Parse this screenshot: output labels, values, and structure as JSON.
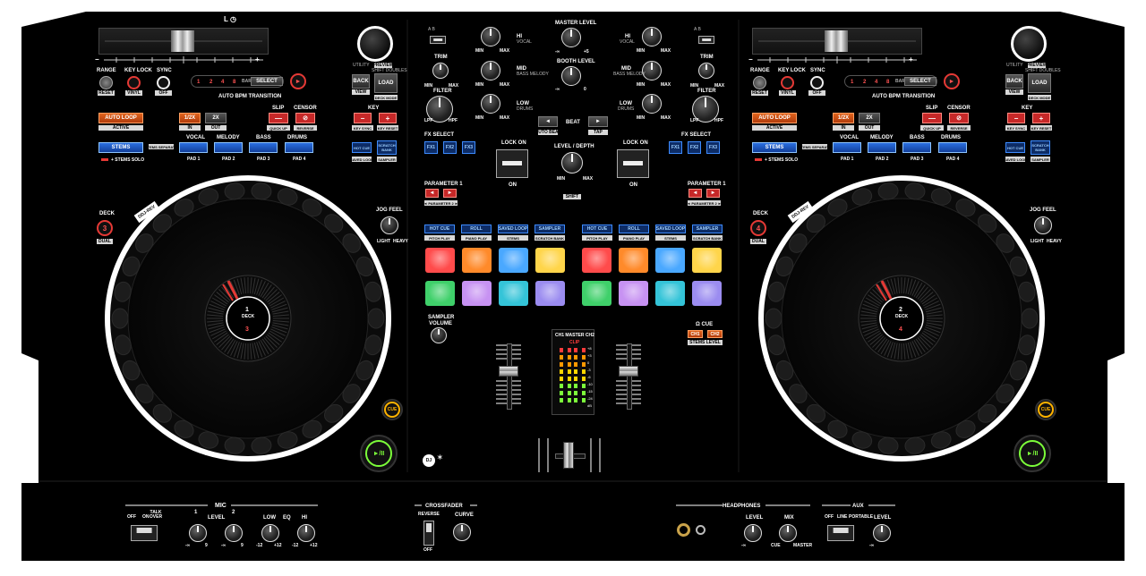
{
  "top_indicator": "L ◷",
  "deck_left": {
    "tempo_plus": "+",
    "tempo_minus": "−",
    "range": "RANGE",
    "range_sub": "RESET",
    "key_lock": "KEY LOCK",
    "key_lock_sub": "VINYL",
    "sync": "SYNC",
    "sync_sub": "OFF",
    "beat_nums": [
      "1",
      "2",
      "4",
      "8"
    ],
    "beat_unit": "BAR",
    "select": "SELECT",
    "auto_bpm": "AUTO BPM TRANSITION",
    "utility": "UTILITY",
    "preview": "PREVIEW",
    "shift_doubles": "SHIFT DOUBLES",
    "back": "BACK",
    "back_sub": "VIEW",
    "load": "LOAD",
    "load_sub": "DECK MODE",
    "auto_loop": "AUTO LOOP",
    "active": "ACTIVE",
    "half": "1/2X",
    "half_sub": "IN",
    "double": "2X",
    "double_sub": "OUT",
    "slip": "SLIP",
    "censor": "CENSOR",
    "slip_sub": "QUICK UP",
    "censor_sub": "REVERSE",
    "key": "KEY",
    "key_sub1": "KEY SYNC",
    "key_sub2": "KEY RESET",
    "stems": "STEMS",
    "stems_separate": "STEMS SEPARATE",
    "stems_solo": "+ STEMS SOLO",
    "vocal": "VOCAL",
    "melody": "MELODY",
    "bass": "BASS",
    "drums": "DRUMS",
    "pad1": "PAD 1",
    "pad2": "PAD 2",
    "pad3": "PAD 3",
    "pad4": "PAD 4",
    "hot_cue": "HOT CUE",
    "scratch_bank": "SCRATCH BANK",
    "saved_loop": "SAVED LOOP",
    "sampler": "SAMPLER",
    "deck": "DECK",
    "deck_num": "3",
    "dual": "DUAL",
    "jog_feel": "JOG FEEL",
    "light": "LIGHT",
    "heavy": "HEAVY",
    "brand": "DDJ-REV",
    "center_top": "1",
    "center_mid": "DECK",
    "center_bot": "3",
    "cue": "CUE",
    "play": "►/II"
  },
  "deck_right": {
    "tempo_plus": "+",
    "tempo_minus": "−",
    "range": "RANGE",
    "range_sub": "RESET",
    "key_lock": "KEY LOCK",
    "key_lock_sub": "VINYL",
    "sync": "SYNC",
    "sync_sub": "OFF",
    "beat_nums": [
      "1",
      "2",
      "4",
      "8"
    ],
    "beat_unit": "BAR",
    "select": "SELECT",
    "auto_bpm": "AUTO BPM TRANSITION",
    "utility": "UTILITY",
    "preview": "PREVIEW",
    "shift_doubles": "SHIFT DOUBLES",
    "back": "BACK",
    "back_sub": "VIEW",
    "load": "LOAD",
    "load_sub": "DECK MODE",
    "auto_loop": "AUTO LOOP",
    "active": "ACTIVE",
    "half": "1/2X",
    "half_sub": "IN",
    "double": "2X",
    "double_sub": "OUT",
    "slip": "SLIP",
    "censor": "CENSOR",
    "slip_sub": "QUICK UP",
    "censor_sub": "REVERSE",
    "key": "KEY",
    "key_sub1": "KEY SYNC",
    "key_sub2": "KEY RESET",
    "stems": "STEMS",
    "stems_separate": "STEMS SEPARATE",
    "stems_solo": "+ STEMS SOLO",
    "vocal": "VOCAL",
    "melody": "MELODY",
    "bass": "BASS",
    "drums": "DRUMS",
    "pad1": "PAD 1",
    "pad2": "PAD 2",
    "pad3": "PAD 3",
    "pad4": "PAD 4",
    "hot_cue": "HOT CUE",
    "scratch_bank": "SCRATCH BANK",
    "saved_loop": "SAVED LOOP",
    "sampler": "SAMPLER",
    "deck": "DECK",
    "deck_num": "4",
    "dual": "DUAL",
    "jog_feel": "JOG FEEL",
    "light": "LIGHT",
    "heavy": "HEAVY",
    "brand": "DDJ-REV",
    "center_top": "2",
    "center_mid": "DECK",
    "center_bot": "4",
    "cue": "CUE",
    "play": "►/II"
  },
  "mixer": {
    "master_level": "MASTER LEVEL",
    "booth_level": "BOOTH LEVEL",
    "hi": "HI",
    "mid": "MID",
    "low": "LOW",
    "vocal_sub": "VOCAL",
    "bass_melody_sub": "BASS MELODY",
    "drum_sub": "DRUMS",
    "trim": "TRIM",
    "filter": "FILTER",
    "min": "MIN",
    "max": "MAX",
    "lpf": "LPF",
    "hpf": "HPF",
    "inf": "-∞",
    "zero": "0",
    "plus5": "+5",
    "db_range": "-18 +18",
    "switch_labels": "A B",
    "beat": "BEAT",
    "auto_beat": "AUTO BEAT",
    "tap": "TAP",
    "fx_select": "FX SELECT",
    "fx1": "FX1",
    "fx2": "FX2",
    "fx3": "FX3",
    "fx_sub": "1",
    "lock_on": "LOCK ON",
    "on": "ON",
    "level_depth": "LEVEL / DEPTH",
    "shift": "SHIFT",
    "parameter1": "PARAMETER 1",
    "parameter2": "◄ PARAMETER 2 ►",
    "mode_buttons": [
      "HOT CUE",
      "ROLL",
      "SAVED LOOP",
      "SAMPLER"
    ],
    "mode_subs": [
      "PITCH PLAY",
      "PIANO PLAY",
      "STEMS",
      "SCRATCH BANK"
    ],
    "pad_colors": [
      "#ff4b4b",
      "#ff8a2a",
      "#4aa8ff",
      "#ffd54a",
      "#ff4b4b",
      "#ff8a2a",
      "#4aa8ff",
      "#ffd54a",
      "#3fd06a",
      "#c792f2",
      "#34c4d8",
      "#9b8cf0",
      "#3fd06a",
      "#c792f2",
      "#34c4d8",
      "#9b8cf0"
    ],
    "sampler_volume": "SAMPLER VOLUME",
    "meter_header": "CH1 MASTER CH2",
    "clip": "CLIP",
    "meter_scale": [
      "+8",
      "+3",
      "0",
      "-3",
      "-6",
      "-10",
      "-15",
      "-24",
      "dB"
    ],
    "cue_label": "Ω CUE",
    "ch1": "CH1",
    "ch2": "CH2",
    "stems_level": "STEMS LEVEL",
    "logo": "DJ"
  },
  "front": {
    "mic": "MIC",
    "mic_off": "OFF",
    "mic_talk": "TALK OVER",
    "mic_on": "ON",
    "level": "LEVEL",
    "mic1": "1",
    "mic2": "2",
    "eq_low": "LOW",
    "eq": "EQ",
    "eq_hi": "HI",
    "minus_inf": "-∞",
    "plus9": "9",
    "minus12": "-12",
    "plus12": "+12",
    "crossfader": "CROSSFADER",
    "reverse": "REVERSE",
    "off": "OFF",
    "curve": "CURVE",
    "headphones": "HEADPHONES",
    "mix": "MIX",
    "cue": "CUE",
    "master": "MASTER",
    "aux": "AUX",
    "aux_off": "OFF",
    "line": "LINE",
    "portable": "PORTABLE"
  }
}
